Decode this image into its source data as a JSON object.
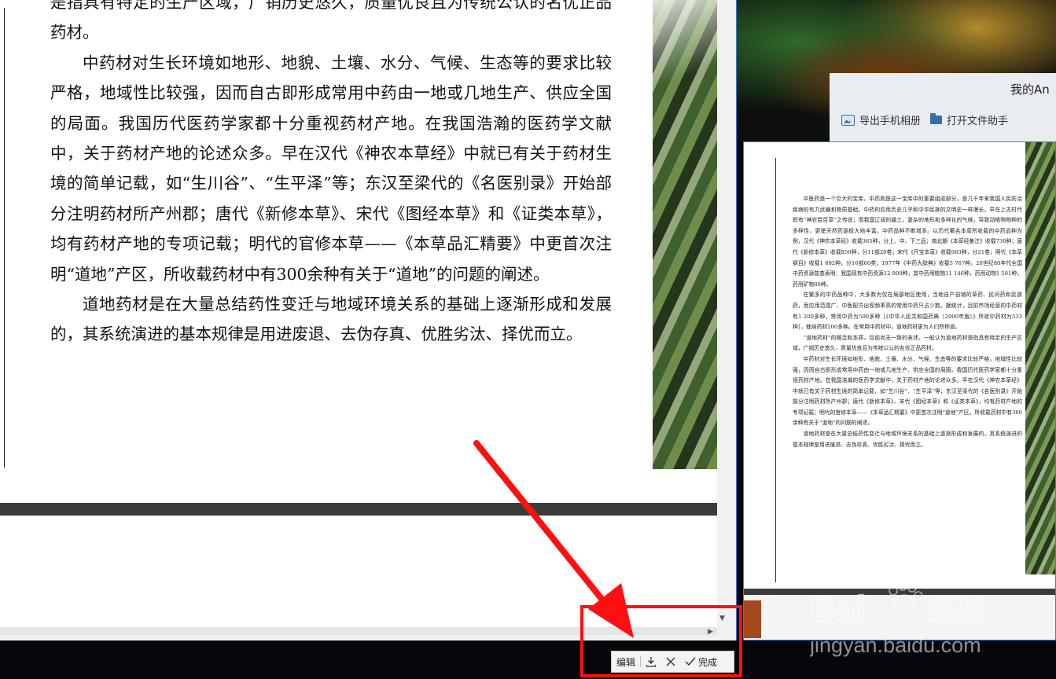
{
  "main_document": {
    "paragraphs": [
      {
        "text": "是指具有特定的生产区域，广销历史悠久，质量优良且为传统公认的名优正品药材。",
        "indent": false
      },
      {
        "text": "中药材对生长环境如地形、地貌、土壤、水分、气候、生态等的要求比较严格，地域性比较强，因而自古即形成常用中药由一地或几地生产、供应全国的局面。我国历代医药学家都十分重视药材产地。在我国浩瀚的医药学文献中，关于药材产地的论述众多。早在汉代《神农本草经》中就已有关于药材生境的简单记载，如“生川谷”、“生平泽”等；东汉至梁代的《名医别录》开始部分注明药材所产州郡；唐代《新修本草》、宋代《图经本草》和《证类本草》，均有药材产地的专项记载；明代的官修本草——《本草品汇精要》中更首次注明“道地”产区，所收载药材中有300余种有关于“道地”的问题的阐述。",
        "indent": true
      },
      {
        "text": "道地药材是在大量总结药性变迁与地域环境关系的基础上逐渐形成和发展的，其系统演进的基本规律是用进废退、去伪存真、优胜劣汰、择优而立。",
        "indent": true
      }
    ]
  },
  "preview_document": {
    "paragraphs": [
      "中医药是一个巨大的宝库，中药则是这一宝库中的重要组成部分，是几千年来我国人民防治疾病的有力武器和物质基础。中药的应用历史几乎和中华民族的文明史一样漫长。早在上古时代即有“神农尝百草”之传说；而我国辽阔的疆土，复杂的地形和多样化的气候，导致动植物物种的多样性，更使天然药源极大地丰富，中药品种不断增多。以历代著名本草所收载的中药品种为例，汉代《神农本草经》收载365种，分上、中、下三品；南北朝《本草经集注》收载730种；唐代《新修本草》收载850种，分11部20卷；宋代《开宝本草》收载983种，分21卷；明代《本草纲目》收载1 892种，分16部60类；1977年《中药大辞典》收载5 767种。20世纪80年代全国中药资源普查表明：我国现有中药资源12 809种，其中药用植物11 146种，药用动物1 581种，药用矿物80种。",
      "在繁多的中药品种中，大多数为仅在局部地区使用，当地自产自销的草药、民间药和民族药，而应用范围广、中医配方出现频率高的常用中药只占少数。据统计，目前市场经营的中药材有1 200多种，常用中药为500多种［《中华人民共和国药典（2000年版）》所收中药材为533种］，栽培药材200多种。在常用中药材中，道地药材更为人们所称道。",
      "“道地药材”的概念和本质，目前尚无一致的表述。一般认为道地药材是指具有特定的生产区域，广销历史悠久，质量优良且为传统公认的名优正品药材。",
      "中药材对生长环境如地形、地貌、土壤、水分、气候、生态等的要求比较严格，地域性比较强，因而自古即形成常用中药由一地或几地生产、供应全国的局面。我国历代医药学家都十分重视药材产地。在我国浩瀚的医药学文献中，关于药材产地的论述众多。早在汉代《神农本草经》中就已有关于药材生境的简单记载，如“生川谷”、“生平泽”等；东汉至梁代的《名医别录》开始部分注明药材所产州郡；唐代《新修本草》、宋代《图经本草》和《证类本草》，均有药材产地的专项记载；明代的官修本草——《本草品汇精要》中更首次注明“道地”产区，所收载药材中有300余种有关于“道地”的问题的阐述。",
      "道地药材是在大量总结药性变迁与地域环境关系的基础上逐渐形成和发展的，其系统演进的基本规律是用进废退、去伪存真、优胜劣汰、择优而立。"
    ]
  },
  "assistant_panel": {
    "title": "我的An",
    "export_album_label": "导出手机相册",
    "open_file_helper_label": "打开文件助手"
  },
  "edit_toolbar": {
    "edit_label": "编辑",
    "download_icon": "download-icon",
    "close_icon": "close-icon",
    "done_label": "完成"
  },
  "watermark": {
    "brand": "Bai",
    "brand_cn": "经验",
    "url": "jingyan.baidu.com"
  },
  "colors": {
    "annotation_red": "#ff1010",
    "window_border": "#3a7bd5",
    "toolbar_bg": "#f3f3f3"
  }
}
